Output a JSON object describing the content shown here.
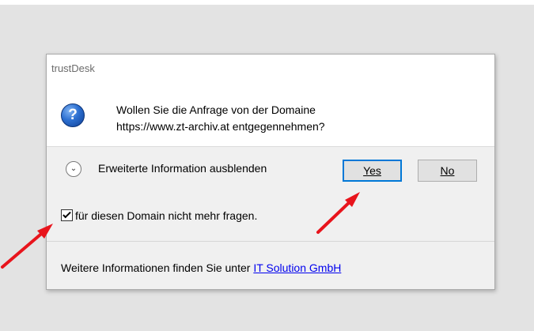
{
  "dialog": {
    "title": "trustDesk",
    "message_line1": "Wollen Sie die Anfrage von der Domaine",
    "message_line2": "https://www.zt-archiv.at entgegennehmen?",
    "question_icon_glyph": "?",
    "expand_label": "Erweiterte Information ausblenden",
    "yes_label": "Yes",
    "no_label": "No",
    "checkbox_label": "für diesen Domain nicht mehr fragen.",
    "checkbox_checked": true,
    "footer_text": "Weitere Informationen finden Sie unter ",
    "footer_link": "IT Solution GmbH"
  },
  "colors": {
    "accent": "#0078d7",
    "link": "#0000ee",
    "annotation_arrow": "#e8141c"
  },
  "icons": [
    "question-icon",
    "chevron-down-icon",
    "checkbox-icon"
  ]
}
